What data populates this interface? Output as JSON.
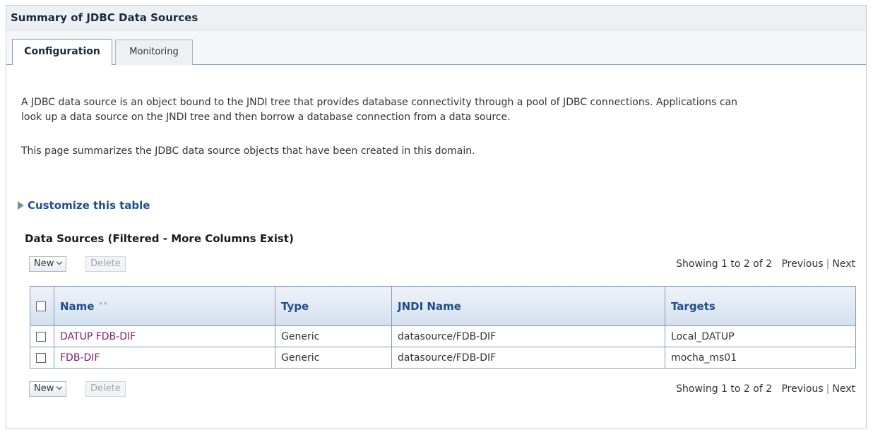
{
  "panel": {
    "title": "Summary of JDBC Data Sources"
  },
  "tabs": [
    {
      "label": "Configuration",
      "active": true
    },
    {
      "label": "Monitoring",
      "active": false
    }
  ],
  "description": {
    "line1": "A JDBC data source is an object bound to the JNDI tree that provides database connectivity through a pool of JDBC connections. Applications can",
    "line2": "look up a data source on the JNDI tree and then borrow a database connection from a data source.",
    "line3": "This page summarizes the JDBC data source objects that have been created in this domain."
  },
  "customize": {
    "label": "Customize this table"
  },
  "table": {
    "title": "Data Sources (Filtered - More Columns Exist)",
    "new_label": "New",
    "delete_label": "Delete",
    "pager": {
      "showing": "Showing 1 to 2 of 2",
      "previous": "Previous",
      "separator": "|",
      "next": "Next"
    },
    "columns": [
      "Name",
      "Type",
      "JNDI Name",
      "Targets"
    ],
    "rows": [
      {
        "name": "DATUP FDB-DIF",
        "type": "Generic",
        "jndi": "datasource/FDB-DIF",
        "targets": "Local_DATUP"
      },
      {
        "name": "FDB-DIF",
        "type": "Generic",
        "jndi": "datasource/FDB-DIF",
        "targets": "mocha_ms01"
      }
    ]
  },
  "colors": {
    "link": "#1f4e8c",
    "visited_link": "#7b1e6c",
    "header_bg": "#d4e0ee",
    "border": "#7f9db9"
  }
}
